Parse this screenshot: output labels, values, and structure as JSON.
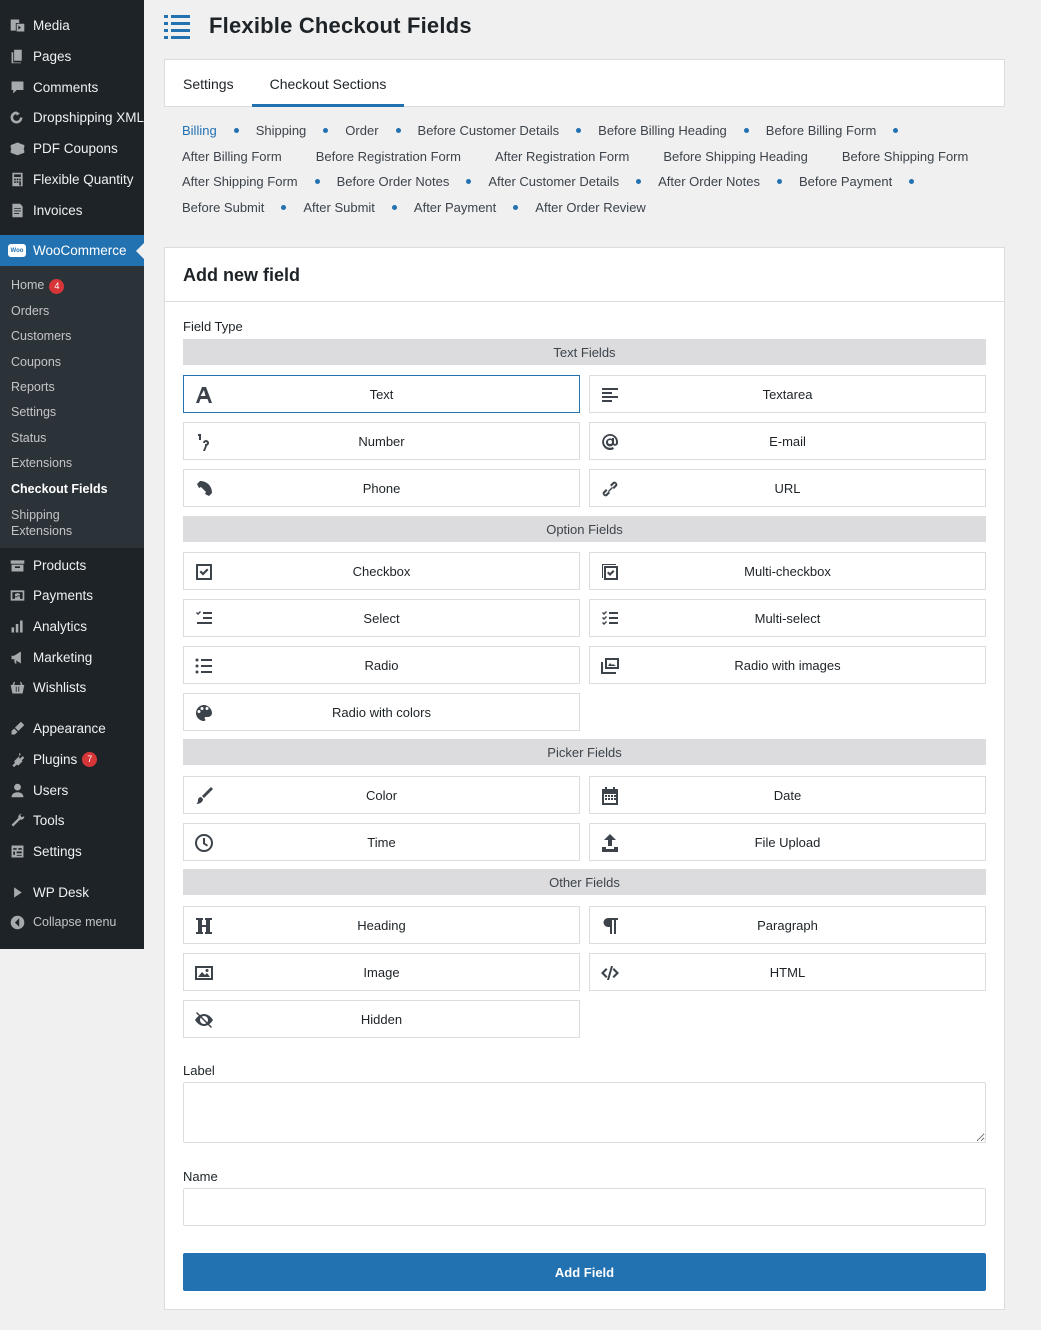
{
  "sidebar": {
    "items_top": [
      {
        "label": "Media",
        "icon": "media-icon"
      },
      {
        "label": "Pages",
        "icon": "pages-icon"
      },
      {
        "label": "Comments",
        "icon": "comments-icon"
      },
      {
        "label": "Dropshipping XML",
        "icon": "dropshipping-icon"
      },
      {
        "label": "PDF Coupons",
        "icon": "pdf-coupons-icon"
      },
      {
        "label": "Flexible Quantity",
        "icon": "flexible-quantity-icon"
      },
      {
        "label": "Invoices",
        "icon": "invoices-icon"
      }
    ],
    "woocommerce": {
      "label": "WooCommerce",
      "icon_text": "Woo"
    },
    "woo_submenu": [
      {
        "label": "Home",
        "badge": "4"
      },
      {
        "label": "Orders"
      },
      {
        "label": "Customers"
      },
      {
        "label": "Coupons"
      },
      {
        "label": "Reports"
      },
      {
        "label": "Settings"
      },
      {
        "label": "Status"
      },
      {
        "label": "Extensions"
      },
      {
        "label": "Checkout Fields"
      },
      {
        "label": "Shipping"
      },
      {
        "label": "Extensions"
      }
    ],
    "items_bottom": [
      {
        "label": "Products",
        "icon": "products-icon"
      },
      {
        "label": "Payments",
        "icon": "payments-icon"
      },
      {
        "label": "Analytics",
        "icon": "analytics-icon"
      },
      {
        "label": "Marketing",
        "icon": "marketing-icon"
      },
      {
        "label": "Wishlists",
        "icon": "wishlists-icon"
      },
      {
        "label": "Appearance",
        "icon": "appearance-icon"
      },
      {
        "label": "Plugins",
        "icon": "plugins-icon",
        "badge": "7"
      },
      {
        "label": "Users",
        "icon": "users-icon"
      },
      {
        "label": "Tools",
        "icon": "tools-icon"
      },
      {
        "label": "Settings",
        "icon": "settings-icon"
      },
      {
        "label": "WP Desk",
        "icon": "wp-desk-icon"
      },
      {
        "label": "Collapse menu",
        "icon": "collapse-icon"
      }
    ]
  },
  "header": {
    "title": "Flexible Checkout Fields"
  },
  "tabs": [
    {
      "label": "Settings"
    },
    {
      "label": "Checkout Sections"
    }
  ],
  "sections": {
    "row1": [
      "Billing",
      "Shipping",
      "Order",
      "Before Customer Details",
      "Before Billing Heading",
      "Before Billing Form"
    ],
    "row2": [
      "After Billing Form",
      "Before Registration Form",
      "After Registration Form",
      "Before Shipping Heading",
      "Before Shipping Form"
    ],
    "row3": [
      "After Shipping Form",
      "Before Order Notes",
      "After Customer Details",
      "After Order Notes",
      "Before Payment"
    ],
    "row4": [
      "Before Submit",
      "After Submit",
      "After Payment",
      "After Order Review"
    ]
  },
  "panel": {
    "title": "Add new field",
    "field_type_label": "Field Type",
    "groups": {
      "text": "Text Fields",
      "option": "Option Fields",
      "picker": "Picker Fields",
      "other": "Other Fields"
    },
    "fields": {
      "text": "Text",
      "textarea": "Textarea",
      "number": "Number",
      "email": "E-mail",
      "phone": "Phone",
      "url": "URL",
      "checkbox": "Checkbox",
      "multi_checkbox": "Multi-checkbox",
      "select": "Select",
      "multi_select": "Multi-select",
      "radio": "Radio",
      "radio_images": "Radio with images",
      "radio_colors": "Radio with colors",
      "color": "Color",
      "date": "Date",
      "time": "Time",
      "file_upload": "File Upload",
      "heading": "Heading",
      "paragraph": "Paragraph",
      "image": "Image",
      "html": "HTML",
      "hidden": "Hidden"
    },
    "label_label": "Label",
    "label_value": "",
    "name_label": "Name",
    "name_value": "",
    "add_button": "Add Field"
  },
  "colors": {
    "accent": "#2271b1",
    "sidebar_bg": "#1d2327",
    "submenu_bg": "#2c3338",
    "badge": "#d63638"
  }
}
